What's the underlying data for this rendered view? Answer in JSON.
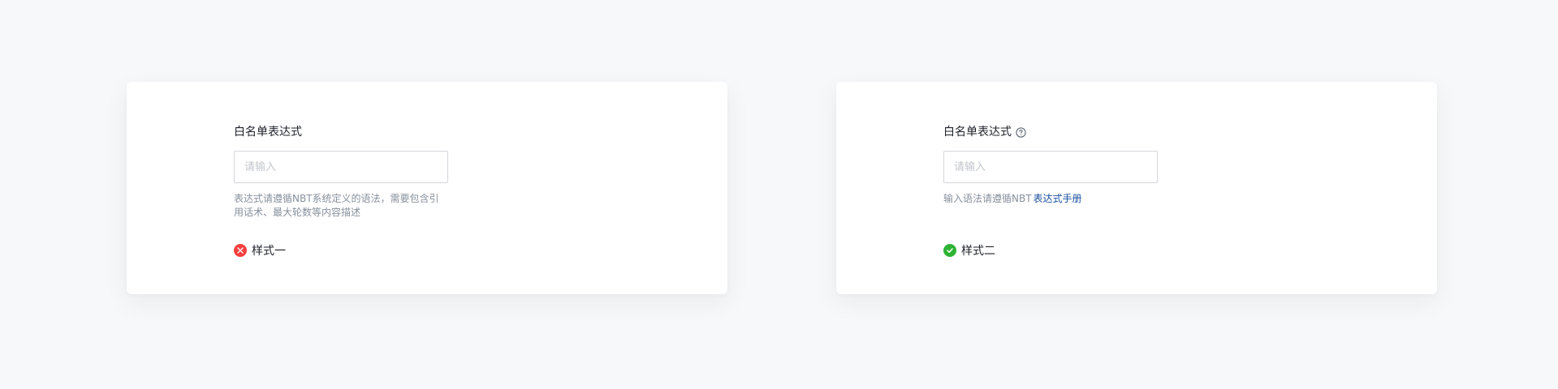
{
  "examples": [
    {
      "id": "style-one",
      "field_label": "白名单表达式",
      "has_help_icon": false,
      "help_icon": null,
      "input": {
        "value": "",
        "placeholder": "请输入"
      },
      "help_text": "表达式请遵循NBT系统定义的语法，需要包含引用话术、最大轮数等内容描述",
      "help_link": null,
      "style_name": "样式一",
      "status": "incorrect",
      "status_icon": "close-circle-icon",
      "status_color": "#f53f3f"
    },
    {
      "id": "style-two",
      "field_label": "白名单表达式",
      "has_help_icon": true,
      "help_icon": "question-circle-icon",
      "input": {
        "value": "",
        "placeholder": "请输入"
      },
      "help_text": "输入语法请遵循NBT",
      "help_link": "表达式手册",
      "help_link_color": "#1a4fa0",
      "style_name": "样式二",
      "status": "correct",
      "status_icon": "check-circle-icon",
      "status_color": "#2fb335"
    }
  ],
  "colors": {
    "page_background": "#f7f8fa",
    "card_background": "#ffffff",
    "input_border": "#d4d6da",
    "help_text": "#86909c",
    "primary_text": "#1d2129"
  }
}
